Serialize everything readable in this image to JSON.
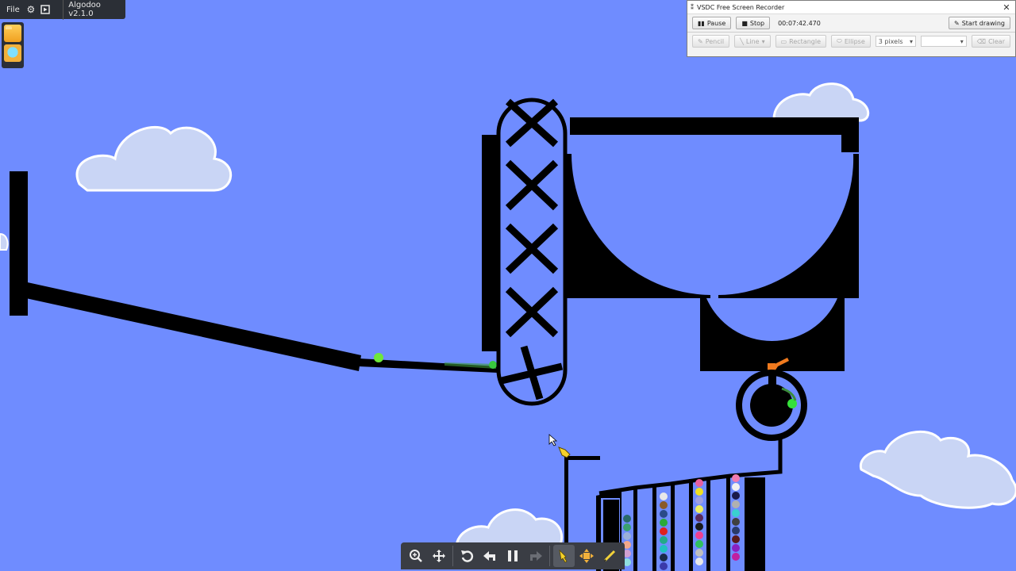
{
  "algodoo": {
    "menu_file": "File",
    "version": "Algodoo v2.1.0",
    "side_buttons": [
      "folder-icon",
      "scene-icon"
    ]
  },
  "vsdc": {
    "title": "VSDC Free Screen Recorder",
    "pause": "Pause",
    "stop": "Stop",
    "time": "00:07:42.470",
    "start_drawing": "Start drawing",
    "pencil": "Pencil",
    "line": "Line",
    "rectangle": "Rectangle",
    "ellipse": "Ellipse",
    "pixels": "3 pixels",
    "clear": "Clear"
  },
  "toolbar": {
    "tools": [
      "zoom-icon",
      "move-icon",
      "reset-icon",
      "undo-icon",
      "pause-icon",
      "redo-icon",
      "drag-hand-icon",
      "move-tool-icon",
      "sketch-icon"
    ]
  },
  "colors": {
    "sky": "#6f8cff",
    "ink": "#000000",
    "accent_green": "#35e03a",
    "accent_orange": "#f07a1e"
  }
}
